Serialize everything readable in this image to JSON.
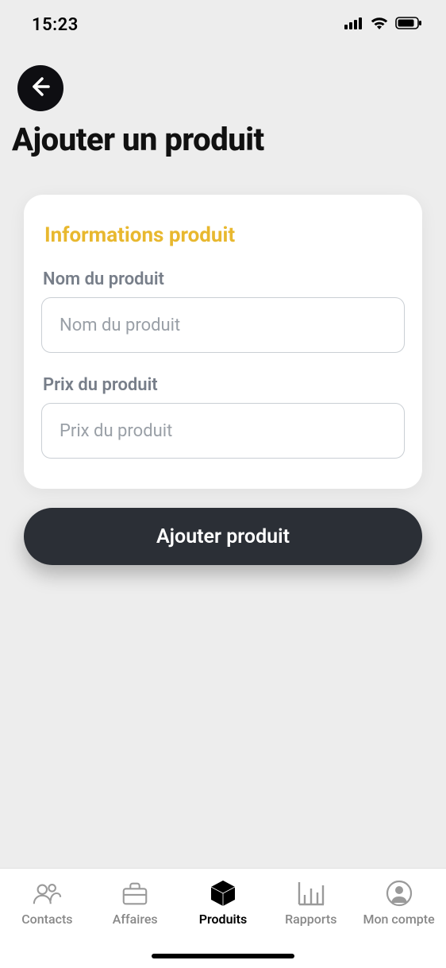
{
  "statusbar": {
    "time": "15:23"
  },
  "page": {
    "title": "Ajouter un produit"
  },
  "form": {
    "section_heading": "Informations produit",
    "name": {
      "label": "Nom du produit",
      "placeholder": "Nom du produit",
      "value": ""
    },
    "price": {
      "label": "Prix du produit",
      "placeholder": "Prix du produit",
      "value": ""
    },
    "submit_label": "Ajouter produit"
  },
  "tabbar": {
    "items": [
      {
        "label": "Contacts",
        "icon": "people-icon",
        "active": false
      },
      {
        "label": "Affaires",
        "icon": "briefcase-icon",
        "active": false
      },
      {
        "label": "Produits",
        "icon": "box-icon",
        "active": true
      },
      {
        "label": "Rapports",
        "icon": "bars-icon",
        "active": false
      },
      {
        "label": "Mon compte",
        "icon": "account-icon",
        "active": false
      }
    ]
  }
}
